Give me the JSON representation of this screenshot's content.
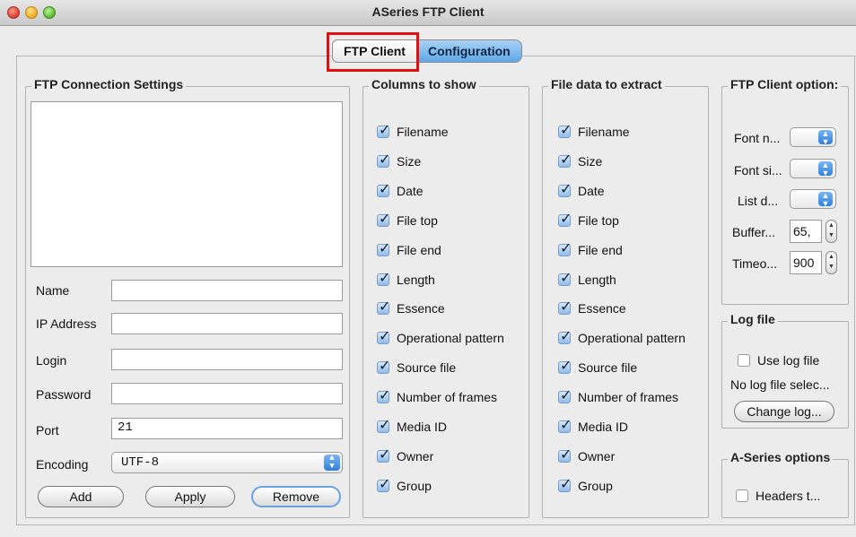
{
  "window": {
    "title": "ASeries FTP Client"
  },
  "tabs": [
    {
      "label": "FTP Client"
    },
    {
      "label": "Configuration"
    }
  ],
  "connection": {
    "legend": "FTP Connection Settings",
    "fields": [
      {
        "label": "Name",
        "value": ""
      },
      {
        "label": "IP Address",
        "value": ""
      },
      {
        "label": "Login",
        "value": ""
      },
      {
        "label": "Password",
        "value": ""
      },
      {
        "label": "Port",
        "value": "21"
      }
    ],
    "encoding": {
      "label": "Encoding",
      "value": "UTF-8"
    },
    "buttons": {
      "add": "Add",
      "apply": "Apply",
      "remove": "Remove"
    }
  },
  "columns_to_show": {
    "legend": "Columns to show",
    "items": [
      "Filename",
      "Size",
      "Date",
      "File top",
      "File end",
      "Length",
      "Essence",
      "Operational pattern",
      "Source file",
      "Number of frames",
      "Media ID",
      "Owner",
      "Group"
    ]
  },
  "file_data": {
    "legend": "File data to extract",
    "items": [
      "Filename",
      "Size",
      "Date",
      "File top",
      "File end",
      "Length",
      "Essence",
      "Operational pattern",
      "Source file",
      "Number of frames",
      "Media ID",
      "Owner",
      "Group"
    ]
  },
  "client_options": {
    "legend": "FTP Client option:",
    "font_name": "Font n...",
    "font_size": "Font si...",
    "list_d": "List d...",
    "buffer": {
      "label": "Buffer...",
      "value": "65,"
    },
    "timeout": {
      "label": "Timeo...",
      "value": "900"
    }
  },
  "log_file": {
    "legend": "Log file",
    "use_label": "Use log file",
    "status": "No log file selec...",
    "change_button": "Change log..."
  },
  "aseries_options": {
    "legend": "A-Series options",
    "headers_label": "Headers t..."
  },
  "colors": {
    "highlight": "#e01010",
    "tab_active_blue": "#5ea8e8"
  }
}
